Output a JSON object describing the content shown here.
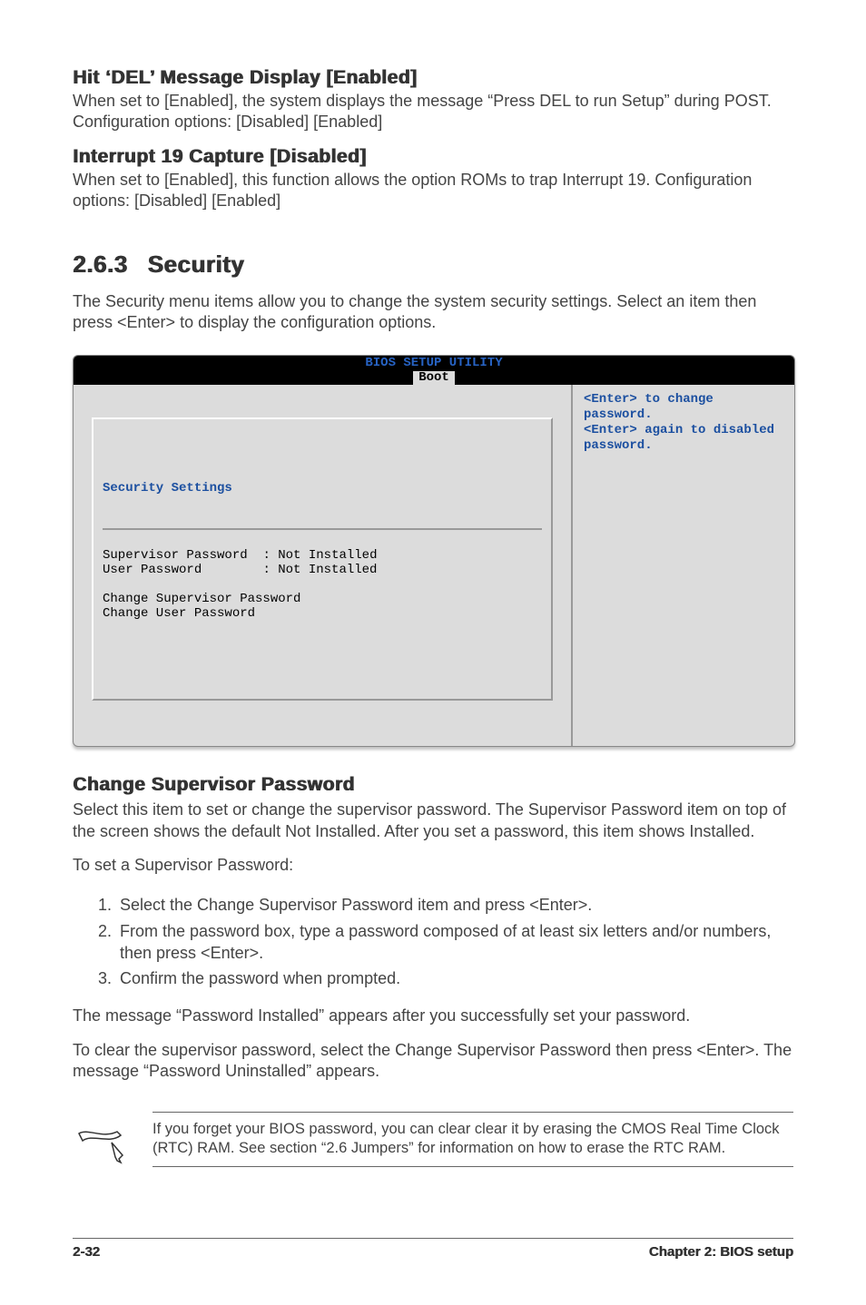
{
  "section1": {
    "title": "Hit ‘DEL’ Message Display [Enabled]",
    "body1": "When set to [Enabled], the system displays the message “Press DEL to run Setup” during POST.",
    "body2": "Configuration options: [Disabled] [Enabled]"
  },
  "section2": {
    "title": "Interrupt 19 Capture [Disabled]",
    "body": "When set to [Enabled], this function allows the option ROMs to trap Interrupt 19. Configuration options: [Disabled] [Enabled]"
  },
  "heading": {
    "num": "2.6.3",
    "text": "Security"
  },
  "intro": "The Security menu items allow you to change the system security settings. Select an item then press <Enter> to display the configuration options.",
  "bios": {
    "header": "BIOS SETUP UTILITY",
    "tab": "Boot",
    "panel_title": "Security Settings",
    "row1_label": "Supervisor Password",
    "row1_value": ": Not Installed",
    "row2_label": "User Password",
    "row2_value": ": Not Installed",
    "action1": "Change Supervisor Password",
    "action2": "Change User Password",
    "help": "<Enter> to change password.\n<Enter> again to disabled password."
  },
  "change_sup": {
    "title": "Change Supervisor Password",
    "p1": "Select this item to set or change the supervisor password. The Supervisor Password item on top of the screen shows the default Not Installed. After you set a password, this item shows Installed.",
    "p2": "To set a Supervisor Password:",
    "steps": [
      "Select the Change Supervisor Password item and press <Enter>.",
      "From the password box, type a password composed of at least six letters and/or numbers, then press <Enter>.",
      "Confirm the password when prompted."
    ],
    "p3": "The message “Password Installed” appears after you successfully set your password.",
    "p4": "To clear the supervisor password, select the Change Supervisor Password then press <Enter>. The message “Password Uninstalled” appears."
  },
  "note": "If you forget your BIOS password, you can clear clear it by erasing the CMOS Real Time Clock (RTC) RAM. See section “2.6  Jumpers” for information on how to erase the RTC RAM.",
  "footer": {
    "left": "2-32",
    "right": "Chapter 2: BIOS setup"
  }
}
